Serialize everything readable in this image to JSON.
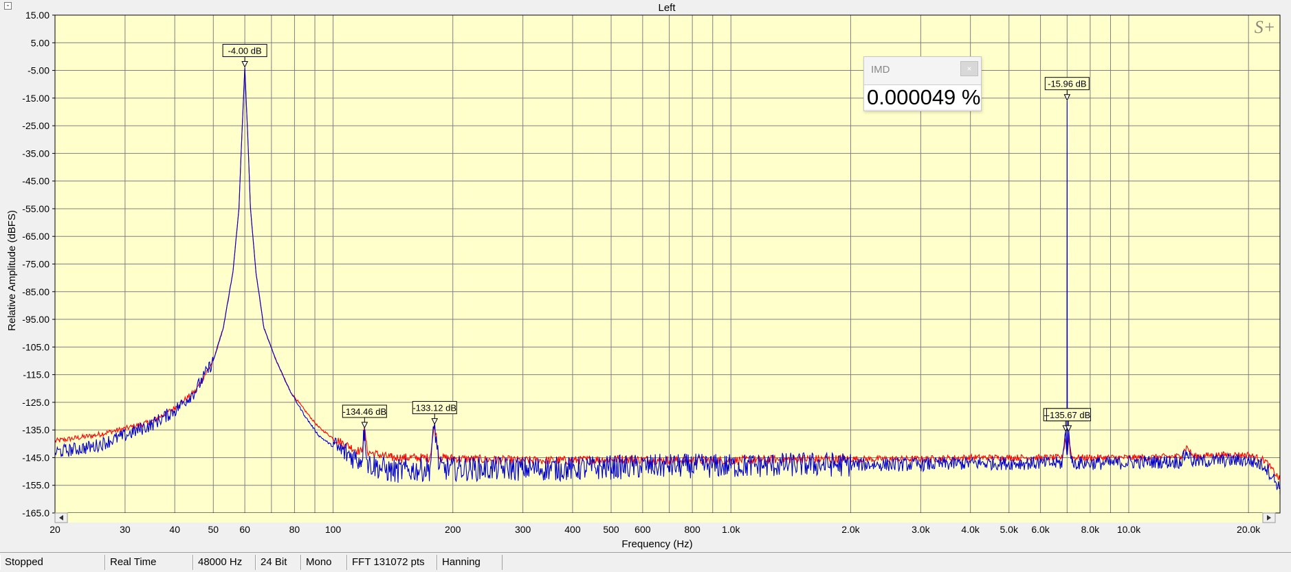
{
  "window": {
    "collapse_glyph": "-"
  },
  "imd_panel": {
    "title": "IMD",
    "close_glyph": "×",
    "value": "0.000049 %"
  },
  "status_bar": [
    {
      "label": "Stopped",
      "width": 153
    },
    {
      "label": "Real Time",
      "width": 128
    },
    {
      "label": "48000 Hz",
      "width": 91
    },
    {
      "label": "24 Bit",
      "width": 66
    },
    {
      "label": "Mono",
      "width": 67
    },
    {
      "label": "FFT 131072 pts",
      "width": 131
    },
    {
      "label": "Hanning",
      "width": 95
    }
  ],
  "chart_data": {
    "type": "line",
    "title": "Left",
    "xlabel": "Frequency (Hz)",
    "ylabel": "Relative Amplitude (dBFS)",
    "x_scale": "log",
    "xlim": [
      20,
      24000
    ],
    "ylim": [
      -165,
      15
    ],
    "grid": true,
    "watermark": "S+",
    "colors": {
      "plot_bg": "#ffffcc",
      "grid": "#7f7f7f",
      "red_series": "#ff0000",
      "blue_series": "#0000cc"
    },
    "x_ticks": [
      {
        "v": 20,
        "label": "20"
      },
      {
        "v": 30,
        "label": "30"
      },
      {
        "v": 40,
        "label": "40"
      },
      {
        "v": 50,
        "label": "50"
      },
      {
        "v": 60,
        "label": "60"
      },
      {
        "v": 80,
        "label": "80"
      },
      {
        "v": 100,
        "label": "100"
      },
      {
        "v": 200,
        "label": "200"
      },
      {
        "v": 300,
        "label": "300"
      },
      {
        "v": 400,
        "label": "400"
      },
      {
        "v": 500,
        "label": "500"
      },
      {
        "v": 600,
        "label": "600"
      },
      {
        "v": 800,
        "label": "800"
      },
      {
        "v": 1000,
        "label": "1.0k"
      },
      {
        "v": 2000,
        "label": "2.0k"
      },
      {
        "v": 3000,
        "label": "3.0k"
      },
      {
        "v": 4000,
        "label": "4.0k"
      },
      {
        "v": 5000,
        "label": "5.0k"
      },
      {
        "v": 6000,
        "label": "6.0k"
      },
      {
        "v": 8000,
        "label": "8.0k"
      },
      {
        "v": 10000,
        "label": "10.0k"
      },
      {
        "v": 20000,
        "label": "20.0k"
      }
    ],
    "x_minor": [
      70,
      90,
      700,
      900,
      7000,
      9000
    ],
    "y_ticks": [
      {
        "v": 15,
        "label": "15.00"
      },
      {
        "v": 5,
        "label": "5.00"
      },
      {
        "v": -5,
        "label": "-5.00"
      },
      {
        "v": -15,
        "label": "-15.00"
      },
      {
        "v": -25,
        "label": "-25.00"
      },
      {
        "v": -35,
        "label": "-35.00"
      },
      {
        "v": -45,
        "label": "-45.00"
      },
      {
        "v": -55,
        "label": "-55.00"
      },
      {
        "v": -65,
        "label": "-65.00"
      },
      {
        "v": -75,
        "label": "-75.00"
      },
      {
        "v": -85,
        "label": "-85.00"
      },
      {
        "v": -95,
        "label": "-95.00"
      },
      {
        "v": -105,
        "label": "-105.0"
      },
      {
        "v": -115,
        "label": "-115.0"
      },
      {
        "v": -125,
        "label": "-125.0"
      },
      {
        "v": -135,
        "label": "-135.0"
      },
      {
        "v": -145,
        "label": "-145.0"
      },
      {
        "v": -155,
        "label": "-155.0"
      },
      {
        "v": -165,
        "label": "-165.0"
      }
    ],
    "markers": [
      {
        "freq": 60,
        "db": -4.0,
        "label": "-4.00 dB"
      },
      {
        "freq": 120,
        "db": -134.46,
        "label": "-134.46 dB"
      },
      {
        "freq": 180,
        "db": -133.12,
        "label": "-133.12 dB"
      },
      {
        "freq": 7000,
        "db": -15.96,
        "label": "-15.96 dB"
      },
      {
        "freq": 6940,
        "db": -135.67,
        "label": "-135.67 dB"
      },
      {
        "freq": 7060,
        "db": -135.67,
        "label": "-135.67 dB"
      }
    ],
    "series": [
      {
        "color": "red",
        "points": [
          [
            20,
            -139
          ],
          [
            25,
            -137
          ],
          [
            30,
            -134.5
          ],
          [
            35,
            -132
          ],
          [
            40,
            -127
          ],
          [
            45,
            -121
          ],
          [
            50,
            -110
          ],
          [
            53,
            -98
          ],
          [
            56,
            -78
          ],
          [
            58,
            -55
          ],
          [
            59,
            -28
          ],
          [
            60,
            -4
          ],
          [
            61,
            -28
          ],
          [
            62,
            -55
          ],
          [
            64,
            -78
          ],
          [
            67,
            -98
          ],
          [
            72,
            -110
          ],
          [
            78,
            -121
          ],
          [
            85,
            -128
          ],
          [
            92,
            -134
          ],
          [
            100,
            -138
          ],
          [
            110,
            -141
          ],
          [
            118,
            -143
          ],
          [
            120,
            -134.5
          ],
          [
            122,
            -143
          ],
          [
            140,
            -145
          ],
          [
            175,
            -145
          ],
          [
            180,
            -133
          ],
          [
            185,
            -145
          ],
          [
            220,
            -145.5
          ],
          [
            300,
            -146
          ],
          [
            400,
            -146
          ],
          [
            500,
            -145.5
          ],
          [
            700,
            -146
          ],
          [
            1000,
            -146
          ],
          [
            1500,
            -145.5
          ],
          [
            2000,
            -145.5
          ],
          [
            3000,
            -145.5
          ],
          [
            4000,
            -145
          ],
          [
            5000,
            -145
          ],
          [
            6000,
            -145
          ],
          [
            6800,
            -145
          ],
          [
            6940,
            -138
          ],
          [
            6990,
            -143
          ],
          [
            7000,
            -76
          ],
          [
            7010,
            -143
          ],
          [
            7060,
            -138
          ],
          [
            7200,
            -145
          ],
          [
            9000,
            -145
          ],
          [
            11000,
            -145
          ],
          [
            13500,
            -144.5
          ],
          [
            14000,
            -141
          ],
          [
            14500,
            -144.5
          ],
          [
            17000,
            -144
          ],
          [
            20000,
            -144
          ],
          [
            22000,
            -146
          ],
          [
            24000,
            -153
          ]
        ]
      },
      {
        "color": "blue",
        "points": [
          [
            20,
            -143
          ],
          [
            25,
            -141
          ],
          [
            30,
            -137
          ],
          [
            35,
            -133
          ],
          [
            40,
            -128
          ],
          [
            45,
            -121
          ],
          [
            50,
            -110
          ],
          [
            53,
            -98
          ],
          [
            56,
            -78
          ],
          [
            58,
            -55
          ],
          [
            59,
            -28
          ],
          [
            60,
            -4
          ],
          [
            61,
            -28
          ],
          [
            62,
            -55
          ],
          [
            64,
            -78
          ],
          [
            67,
            -98
          ],
          [
            72,
            -110
          ],
          [
            78,
            -121
          ],
          [
            85,
            -130
          ],
          [
            92,
            -137
          ],
          [
            100,
            -141
          ],
          [
            110,
            -144
          ],
          [
            118,
            -146
          ],
          [
            120,
            -134.5
          ],
          [
            122,
            -147
          ],
          [
            140,
            -150
          ],
          [
            175,
            -149
          ],
          [
            180,
            -133
          ],
          [
            185,
            -149
          ],
          [
            250,
            -149
          ],
          [
            300,
            -149
          ],
          [
            400,
            -149
          ],
          [
            500,
            -148.5
          ],
          [
            700,
            -148
          ],
          [
            1000,
            -148
          ],
          [
            1500,
            -147.5
          ],
          [
            2000,
            -147.5
          ],
          [
            3000,
            -147.5
          ],
          [
            4000,
            -147
          ],
          [
            5000,
            -147
          ],
          [
            6000,
            -147
          ],
          [
            6800,
            -147
          ],
          [
            6940,
            -136
          ],
          [
            6990,
            -144
          ],
          [
            7000,
            -16
          ],
          [
            7010,
            -144
          ],
          [
            7060,
            -136
          ],
          [
            7200,
            -147
          ],
          [
            9000,
            -147
          ],
          [
            11000,
            -146.5
          ],
          [
            13500,
            -146.5
          ],
          [
            14000,
            -143
          ],
          [
            14500,
            -146.5
          ],
          [
            17000,
            -146
          ],
          [
            20000,
            -146
          ],
          [
            22000,
            -148
          ],
          [
            24000,
            -156
          ]
        ]
      }
    ]
  }
}
